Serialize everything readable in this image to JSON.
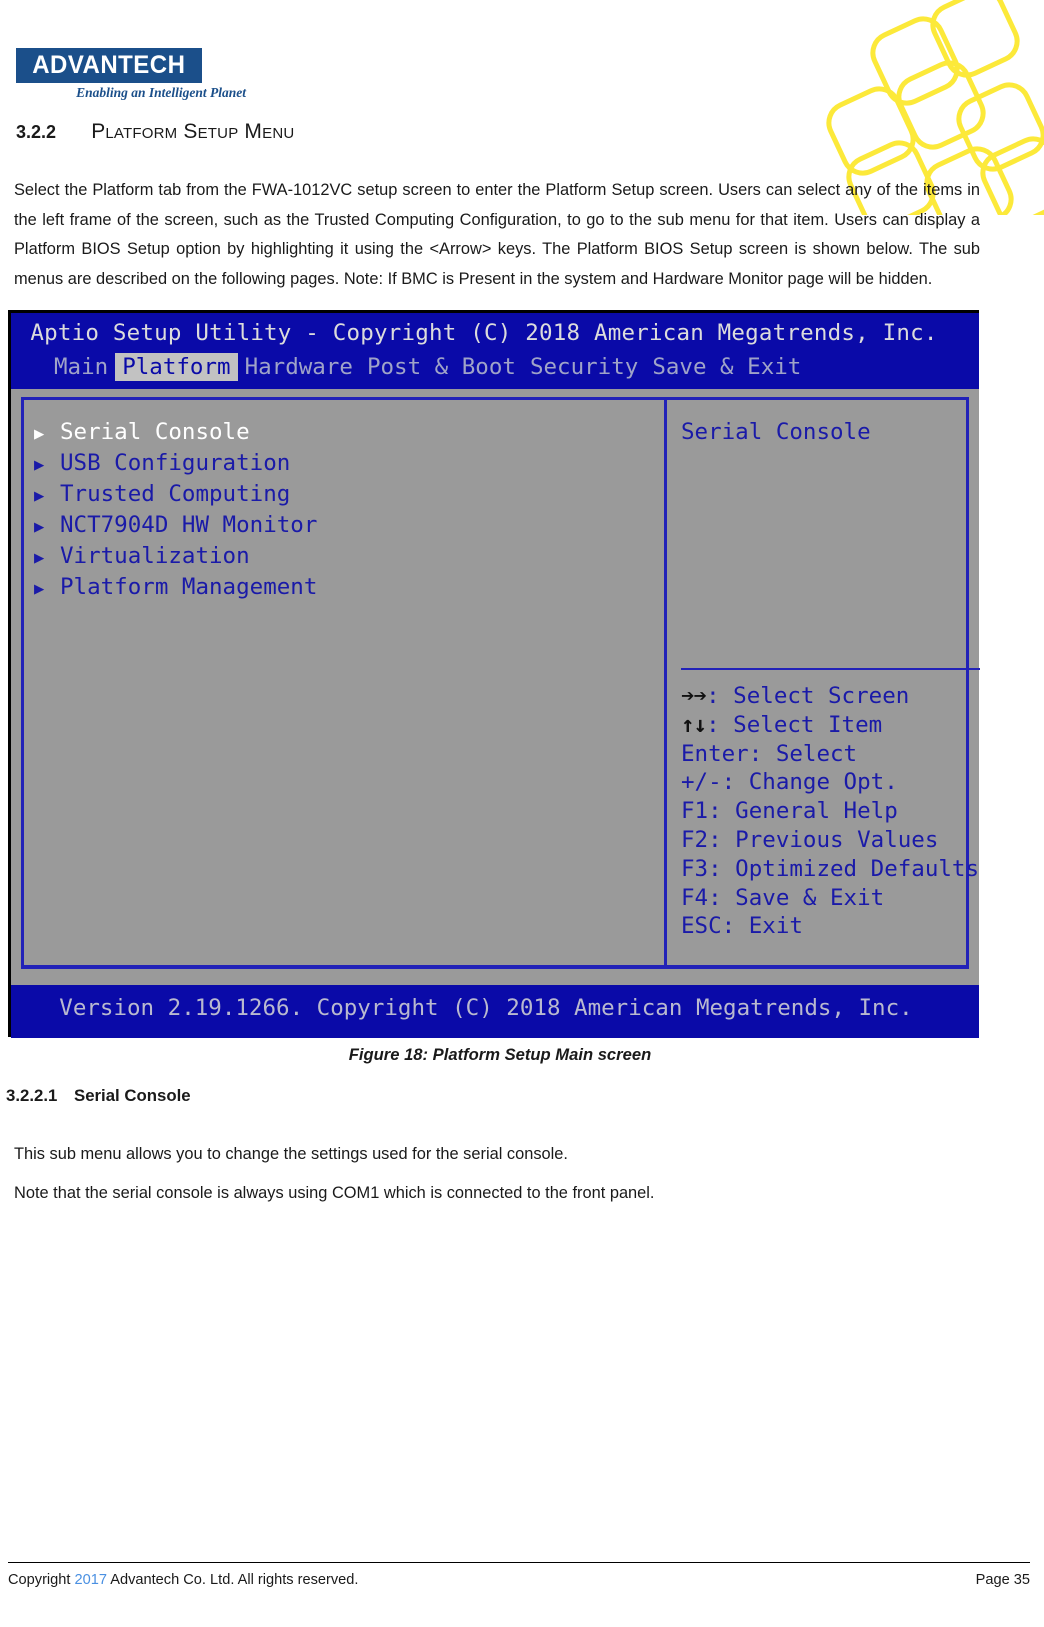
{
  "brand": {
    "logo_text": "ADVANTECH",
    "tagline": "Enabling an Intelligent Planet",
    "logo_color": "#1B4F8A"
  },
  "section": {
    "number": "3.2.2",
    "title": "Platform Setup Menu"
  },
  "body": {
    "paragraph1": "Select the Platform tab from the FWA-1012VC setup screen to enter the Platform Setup screen. Users can select any of the items in the left frame of the screen, such as the Trusted Computing Configuration, to go to the sub menu for that item. Users can display a Platform BIOS Setup option by highlighting it using the <Arrow> keys. The Platform BIOS Setup screen is shown below. The sub menus are described on the following pages. Note: If BMC is Present in the system and Hardware Monitor page will be hidden."
  },
  "bios": {
    "title": "Aptio Setup Utility - Copyright (C) 2018 American Megatrends, Inc.",
    "tabs": [
      {
        "label": "Main",
        "active": false
      },
      {
        "label": "Platform",
        "active": true
      },
      {
        "label": "Hardware",
        "active": false
      },
      {
        "label": "Post & Boot",
        "active": false
      },
      {
        "label": "Security",
        "active": false
      },
      {
        "label": "Save & Exit",
        "active": false
      }
    ],
    "menu_items": [
      {
        "label": "Serial Console",
        "selected": true
      },
      {
        "label": "USB Configuration",
        "selected": false
      },
      {
        "label": "Trusted Computing",
        "selected": false
      },
      {
        "label": "NCT7904D HW Monitor",
        "selected": false
      },
      {
        "label": "Virtualization",
        "selected": false
      },
      {
        "label": "Platform Management",
        "selected": false
      }
    ],
    "help_title": "Serial Console",
    "keys": [
      {
        "glyph": "➔➔",
        "text": ": Select Screen"
      },
      {
        "glyph": "↑↓",
        "text": ": Select Item"
      },
      {
        "glyph": "",
        "text": "Enter: Select"
      },
      {
        "glyph": "",
        "text": "+/-: Change Opt."
      },
      {
        "glyph": "",
        "text": "F1: General Help"
      },
      {
        "glyph": "",
        "text": "F2: Previous Values"
      },
      {
        "glyph": "",
        "text": "F3: Optimized Defaults"
      },
      {
        "glyph": "",
        "text": "F4: Save & Exit"
      },
      {
        "glyph": "",
        "text": "ESC: Exit"
      }
    ],
    "version": "Version 2.19.1266. Copyright (C) 2018 American Megatrends, Inc."
  },
  "figure": {
    "caption": "Figure 18: Platform Setup Main screen"
  },
  "subsection": {
    "number": "3.2.2.1",
    "title": "Serial Console",
    "paragraph1": "This sub menu allows you to change the settings used for the serial console.",
    "paragraph2": "Note that the serial console is always using COM1 which is connected to the front panel."
  },
  "footer": {
    "copyright_pre": "Copyright",
    "year": "2017",
    "copyright_post": "Advantech Co. Ltd. All rights reserved.",
    "page": "Page 35"
  }
}
